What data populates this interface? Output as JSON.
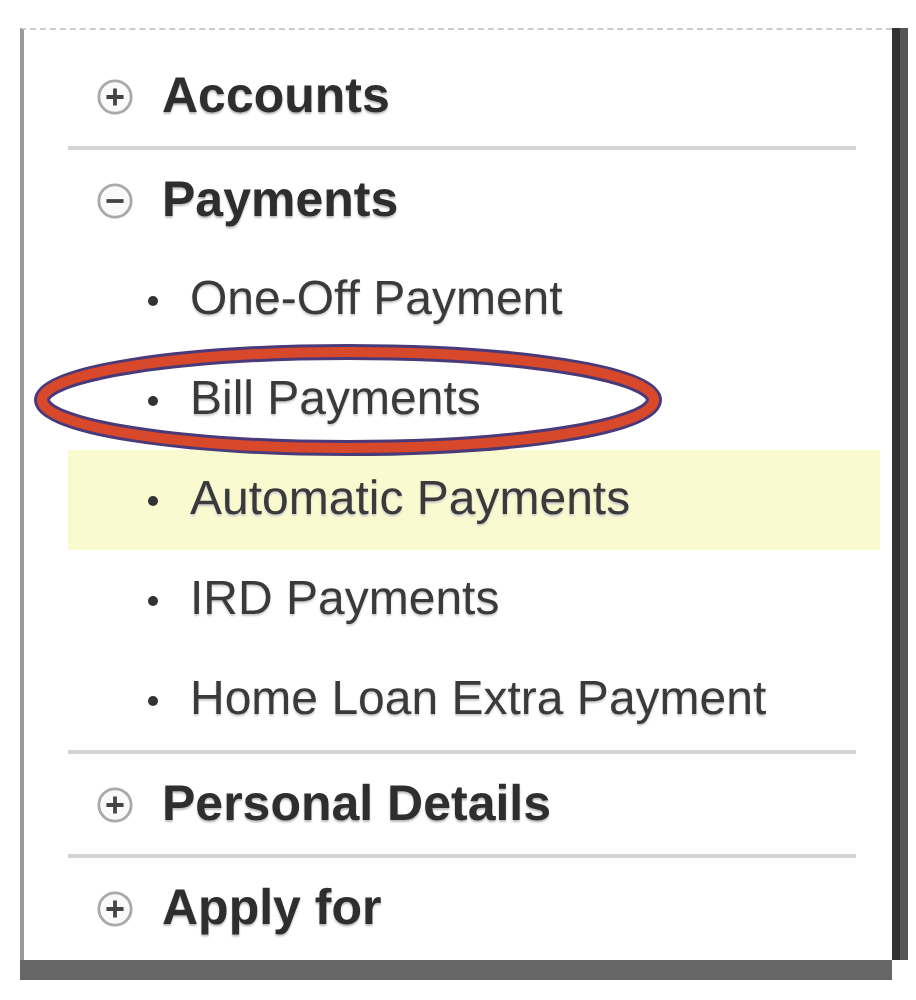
{
  "menu": {
    "sections": [
      {
        "label": "Accounts",
        "expanded": false
      },
      {
        "label": "Payments",
        "expanded": true,
        "children": [
          {
            "label": "One-Off Payment",
            "selected": false
          },
          {
            "label": "Bill Payments",
            "selected": false
          },
          {
            "label": "Automatic Payments",
            "selected": true
          },
          {
            "label": "IRD Payments",
            "selected": false
          },
          {
            "label": "Home Loan Extra Payment",
            "selected": false
          }
        ]
      },
      {
        "label": "Personal Details",
        "expanded": false
      },
      {
        "label": "Apply for",
        "expanded": false
      }
    ]
  }
}
